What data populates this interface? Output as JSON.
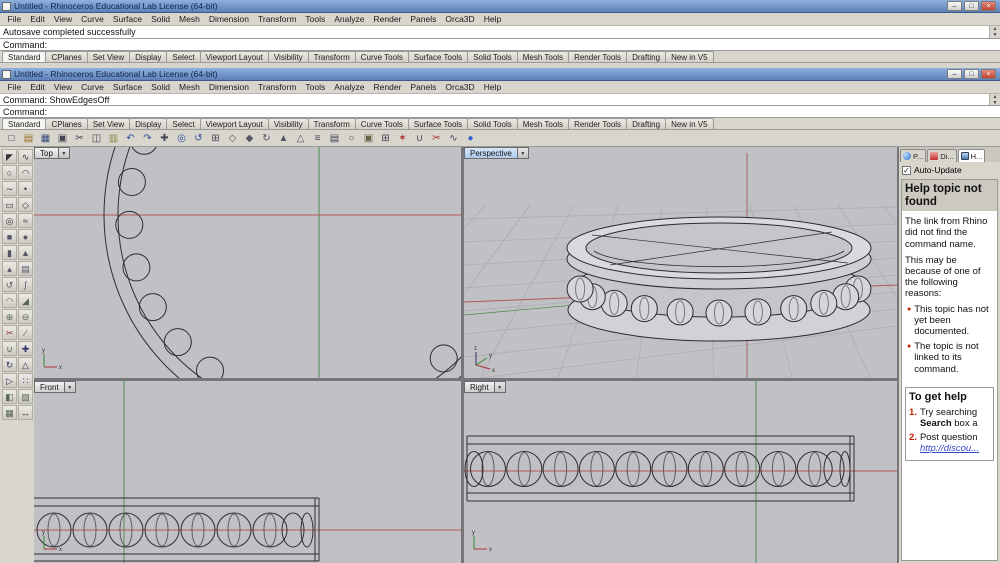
{
  "menu": [
    "File",
    "Edit",
    "View",
    "Curve",
    "Surface",
    "Solid",
    "Mesh",
    "Dimension",
    "Transform",
    "Tools",
    "Analyze",
    "Render",
    "Panels",
    "Orca3D",
    "Help"
  ],
  "toolbar_tabs": [
    "Standard",
    "CPlanes",
    "Set View",
    "Display",
    "Select",
    "Viewport Layout",
    "Visibility",
    "Transform",
    "Curve Tools",
    "Surface Tools",
    "Solid Tools",
    "Mesh Tools",
    "Render Tools",
    "Drafting",
    "New in V5"
  ],
  "back_window": {
    "title": "Untitled - Rhinoceros Educational Lab License (64-bit)",
    "history_line": "Autosave completed successfully",
    "prompt_label": "Command:"
  },
  "front_window": {
    "title": "Untitled - Rhinoceros Educational Lab License (64-bit)",
    "history_line": "Command: ShowEdgesOff",
    "prompt_label": "Command:"
  },
  "icons": {
    "minimize": "–",
    "restore": "□",
    "close": "×",
    "scroll_up": "▲",
    "scroll_down": "▼",
    "dropdown": "▼",
    "check": "✓"
  },
  "axis": {
    "x": "x",
    "y": "y",
    "z": "z"
  },
  "viewports": {
    "top": "Top",
    "perspective": "Perspective",
    "front": "Front",
    "right": "Right"
  },
  "toolbar_icons": [
    {
      "name": "new-file",
      "glyph": "□",
      "color": "#444455"
    },
    {
      "name": "open-file",
      "glyph": "▤",
      "color": "#996a22"
    },
    {
      "name": "save",
      "glyph": "▦",
      "color": "#334a77"
    },
    {
      "name": "print",
      "glyph": "▣",
      "color": "#444455"
    },
    {
      "name": "cut",
      "glyph": "✂",
      "color": "#444455"
    },
    {
      "name": "copy",
      "glyph": "◫",
      "color": "#444455"
    },
    {
      "name": "paste",
      "glyph": "▥",
      "color": "#888844"
    },
    {
      "name": "undo",
      "glyph": "↶",
      "color": "#2a4a99"
    },
    {
      "name": "redo",
      "glyph": "↷",
      "color": "#2a4a99"
    },
    {
      "name": "pan",
      "glyph": "✚",
      "color": "#444455"
    },
    {
      "name": "zoom",
      "glyph": "◎",
      "color": "#2a4a99"
    },
    {
      "name": "rotate-view",
      "glyph": "↺",
      "color": "#2a4a99"
    },
    {
      "name": "zoom-extents",
      "glyph": "⊞",
      "color": "#444455"
    },
    {
      "name": "move",
      "glyph": "◇",
      "color": "#555566"
    },
    {
      "name": "copy-object",
      "glyph": "◆",
      "color": "#555566"
    },
    {
      "name": "rotate",
      "glyph": "↻",
      "color": "#555566"
    },
    {
      "name": "scale",
      "glyph": "▲",
      "color": "#555566"
    },
    {
      "name": "mirror",
      "glyph": "△",
      "color": "#555566"
    },
    {
      "name": "layers",
      "glyph": "≡",
      "color": "#444455"
    },
    {
      "name": "properties",
      "glyph": "▤",
      "color": "#444455"
    },
    {
      "name": "hide",
      "glyph": "○",
      "color": "#444455"
    },
    {
      "name": "lock",
      "glyph": "▣",
      "color": "#666644"
    },
    {
      "name": "group",
      "glyph": "⊞",
      "color": "#444455"
    },
    {
      "name": "explode",
      "glyph": "✶",
      "color": "#aa3333"
    },
    {
      "name": "join",
      "glyph": "∪",
      "color": "#444455"
    },
    {
      "name": "trim",
      "glyph": "✂",
      "color": "#aa3333"
    },
    {
      "name": "split",
      "glyph": "∿",
      "color": "#444455"
    },
    {
      "name": "render",
      "glyph": "●",
      "color": "#3366cc"
    }
  ],
  "sidebar_icons": [
    {
      "name": "select-arrow",
      "glyph": "◤",
      "color": "#333333"
    },
    {
      "name": "polyline",
      "glyph": "∿",
      "color": "#333344"
    },
    {
      "name": "circle",
      "glyph": "○",
      "color": "#333344"
    },
    {
      "name": "arc",
      "glyph": "◠",
      "color": "#333344"
    },
    {
      "name": "freeform-curve",
      "glyph": "∼",
      "color": "#333344"
    },
    {
      "name": "point",
      "glyph": "•",
      "color": "#333344"
    },
    {
      "name": "rectangle",
      "glyph": "▭",
      "color": "#333344"
    },
    {
      "name": "polygon",
      "glyph": "◇",
      "color": "#333344"
    },
    {
      "name": "ellipse",
      "glyph": "◎",
      "color": "#333344"
    },
    {
      "name": "offset",
      "glyph": "≈",
      "color": "#333344"
    },
    {
      "name": "box",
      "glyph": "■",
      "color": "#555566"
    },
    {
      "name": "sphere",
      "glyph": "●",
      "color": "#555566"
    },
    {
      "name": "cylinder",
      "glyph": "▮",
      "color": "#555566"
    },
    {
      "name": "cone",
      "glyph": "▲",
      "color": "#555566"
    },
    {
      "name": "extrude",
      "glyph": "▴",
      "color": "#555566"
    },
    {
      "name": "loft",
      "glyph": "▤",
      "color": "#555566"
    },
    {
      "name": "revolve",
      "glyph": "↺",
      "color": "#555566"
    },
    {
      "name": "sweep",
      "glyph": "∫",
      "color": "#555566"
    },
    {
      "name": "fillet",
      "glyph": "◠",
      "color": "#556655"
    },
    {
      "name": "chamfer",
      "glyph": "◢",
      "color": "#556655"
    },
    {
      "name": "boolean-union",
      "glyph": "⊕",
      "color": "#556655"
    },
    {
      "name": "boolean-difference",
      "glyph": "⊖",
      "color": "#556655"
    },
    {
      "name": "trim-tool",
      "glyph": "✂",
      "color": "#993333"
    },
    {
      "name": "split-tool",
      "glyph": "∕",
      "color": "#556655"
    },
    {
      "name": "join-tool",
      "glyph": "∪",
      "color": "#556655"
    },
    {
      "name": "move-tool",
      "glyph": "✚",
      "color": "#333366"
    },
    {
      "name": "rotate-tool",
      "glyph": "↻",
      "color": "#333366"
    },
    {
      "name": "scale-tool",
      "glyph": "△",
      "color": "#333366"
    },
    {
      "name": "mirror-tool",
      "glyph": "▷",
      "color": "#333366"
    },
    {
      "name": "array",
      "glyph": "∷",
      "color": "#333366"
    },
    {
      "name": "curve-boolean",
      "glyph": "◧",
      "color": "#556655"
    },
    {
      "name": "surface-tool",
      "glyph": "▨",
      "color": "#556655"
    },
    {
      "name": "mesh-tool",
      "glyph": "▦",
      "color": "#556655"
    },
    {
      "name": "dimension",
      "glyph": "↔",
      "color": "#333333"
    }
  ],
  "help_panel": {
    "tabs": [
      {
        "label": "P...",
        "icon": "properties"
      },
      {
        "label": "Di...",
        "icon": "display"
      },
      {
        "label": "H...",
        "icon": "help"
      }
    ],
    "active_tab": 2,
    "auto_update_label": "Auto-Update",
    "heading": "Help topic not found",
    "paragraphs": [
      "The link from Rhino did not find the command name.",
      "This may be because of one of the following reasons:"
    ],
    "bullets": [
      "This topic has not yet been documented.",
      "The topic is not linked to its command."
    ],
    "get_help": {
      "title": "To get help",
      "items": [
        {
          "num": "1.",
          "pre": "Try searching",
          "bold": "Search",
          "post": " box a"
        },
        {
          "num": "2.",
          "pre": "Post question",
          "link": "http://discou..."
        }
      ]
    }
  }
}
